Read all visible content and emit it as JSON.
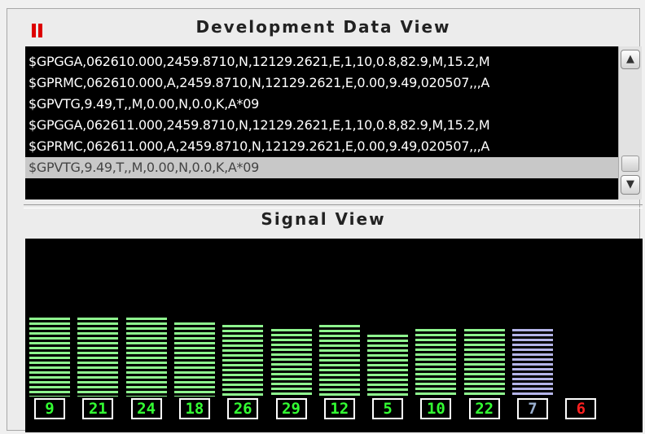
{
  "development_view": {
    "title": "Development Data View",
    "lines": [
      "$GPGGA,062610.000,2459.8710,N,12129.2621,E,1,10,0.8,82.9,M,15.2,M",
      "$GPRMC,062610.000,A,2459.8710,N,12129.2621,E,0.00,9.49,020507,,,A",
      "$GPVTG,9.49,T,,M,0.00,N,0.0,K,A*09",
      "$GPGGA,062611.000,2459.8710,N,12129.2621,E,1,10,0.8,82.9,M,15.2,M",
      "$GPRMC,062611.000,A,2459.8710,N,12129.2621,E,0.00,9.49,020507,,,A",
      "$GPVTG,9.49,T,,M,0.00,N,0.0,K,A*09"
    ],
    "selected_line": 5
  },
  "signal_view": {
    "title": "Signal View",
    "satellites": [
      {
        "prn": "9",
        "level": 0.7,
        "state": "used"
      },
      {
        "prn": "21",
        "level": 0.7,
        "state": "used"
      },
      {
        "prn": "24",
        "level": 0.7,
        "state": "used"
      },
      {
        "prn": "18",
        "level": 0.66,
        "state": "used"
      },
      {
        "prn": "26",
        "level": 0.64,
        "state": "used"
      },
      {
        "prn": "29",
        "level": 0.6,
        "state": "used"
      },
      {
        "prn": "12",
        "level": 0.64,
        "state": "used"
      },
      {
        "prn": "5",
        "level": 0.55,
        "state": "used"
      },
      {
        "prn": "10",
        "level": 0.6,
        "state": "used"
      },
      {
        "prn": "22",
        "level": 0.6,
        "state": "used"
      },
      {
        "prn": "7",
        "level": 0.6,
        "state": "tracked"
      },
      {
        "prn": "6",
        "level": 0.0,
        "state": "lost"
      }
    ]
  },
  "colors": {
    "used": "#8ef58e",
    "tracked": "#b4b4e8",
    "used_label": "#33ff33",
    "tracked_label": "#9ab0d0",
    "lost_label": "#ff2020",
    "pause": "#dd0000"
  },
  "icons": {
    "pause": "pause-icon",
    "scroll_up": "chevron-up-icon",
    "scroll_down": "chevron-down-icon"
  },
  "scroll_glyphs": {
    "up": "▲",
    "down": "▼"
  }
}
